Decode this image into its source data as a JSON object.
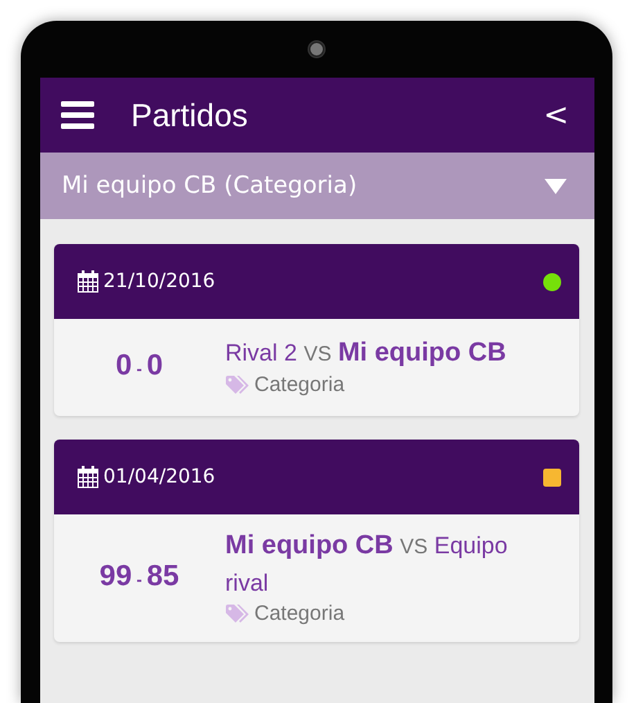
{
  "app_bar": {
    "title": "Partidos",
    "back": "<"
  },
  "team_selector": {
    "value": "Mi equipo CB (Categoria)"
  },
  "matches": [
    {
      "date": "21/10/2016",
      "status": {
        "kind": "circle",
        "color": "#76e00a"
      },
      "score": {
        "home": "0",
        "separator": "-",
        "away": "0"
      },
      "teams": [
        {
          "name": "Rival 2",
          "highlighted": false
        },
        {
          "name": "Mi equipo CB",
          "highlighted": true
        }
      ],
      "versus": "VS",
      "category": "Categoria"
    },
    {
      "date": "01/04/2016",
      "status": {
        "kind": "square",
        "color": "#f7b731"
      },
      "score": {
        "home": "99",
        "separator": "-",
        "away": "85"
      },
      "teams": [
        {
          "name": "Mi equipo CB",
          "highlighted": true
        },
        {
          "name": "Equipo rival",
          "highlighted": false
        }
      ],
      "versus": "VS",
      "category": "Categoria"
    }
  ]
}
